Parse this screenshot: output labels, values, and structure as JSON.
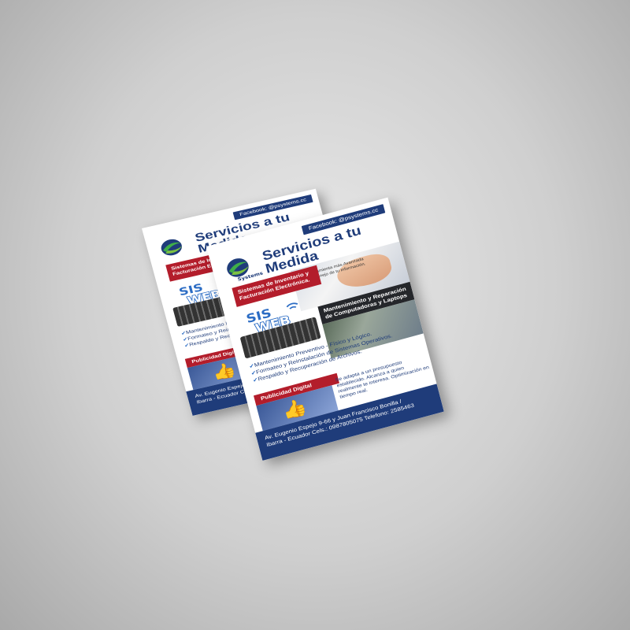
{
  "flyer": {
    "facebook": "Facebook: @psystems.cc",
    "title": "Servicios a tu Medida",
    "brand": "Systems",
    "red_banner": "Sistemas de Inventario y Facturación Electrónica.",
    "hero_text": "Es la herramienta más Avanzada para el manejo de tu información.",
    "sis": "SIS",
    "web": "WEB",
    "dark_banner": "Mantenimiento y Reparación de Computadoras y Laptops",
    "checks": [
      "Mantenimiento Preventivo - Físico y Lógico.",
      "Formateo y Reinstalación de Sistemas Operativos.",
      "Respaldo y Recuperación de Archivos."
    ],
    "pub_banner": "Publicidad Digital",
    "pub_text": "Se adapta a un presupuesto establecido. Alcanza a quien realmente te interesa. Optimización en tiempo real.",
    "footer_line1": "Av. Eugenio Espejo 9-66 y Juan Francisco Bonilla /",
    "footer_line2": "Ibarra - Ecuador   Cels.: 0987805075   Telefono: 2585463"
  },
  "colors": {
    "navy": "#1f3c7a",
    "red": "#b31d2b",
    "background": "#d4d4d4"
  },
  "icons": [
    "check-icon",
    "like-icon",
    "wifi-icon"
  ]
}
